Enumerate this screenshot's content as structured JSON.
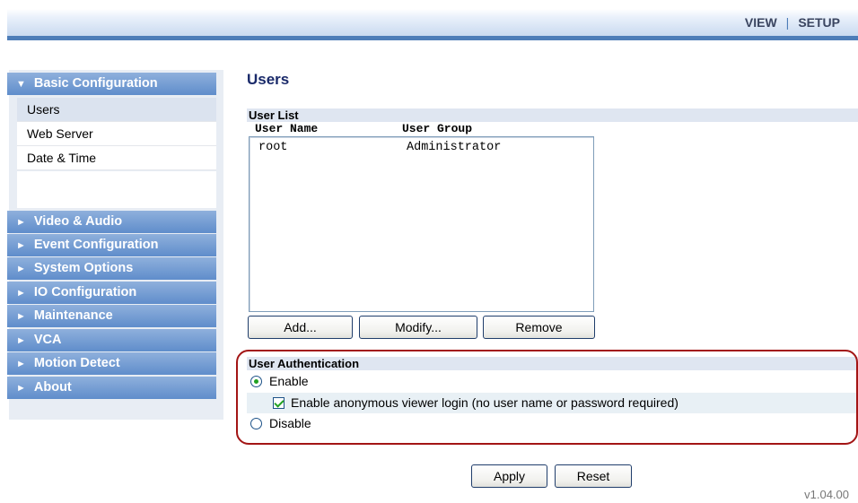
{
  "header": {
    "nav": [
      {
        "label": "VIEW"
      },
      {
        "label": "SETUP"
      }
    ],
    "separator": "|"
  },
  "sidebar": {
    "groups": [
      {
        "label": "Basic Configuration",
        "expanded": true,
        "items": [
          {
            "label": "Users",
            "active": true
          },
          {
            "label": "Web Server"
          },
          {
            "label": "Date & Time"
          }
        ]
      },
      {
        "label": "Video & Audio"
      },
      {
        "label": "Event Configuration"
      },
      {
        "label": "System Options"
      },
      {
        "label": "IO Configuration"
      },
      {
        "label": "Maintenance"
      },
      {
        "label": "VCA"
      },
      {
        "label": "Motion Detect"
      },
      {
        "label": "About"
      }
    ],
    "expanded_arrow": "▼",
    "collapsed_arrow": "►"
  },
  "main": {
    "title": "Users",
    "user_list": {
      "heading": "User List",
      "columns": [
        "User Name",
        "User Group"
      ],
      "rows": [
        [
          "root",
          "Administrator"
        ]
      ],
      "buttons": {
        "add": "Add...",
        "modify": "Modify...",
        "remove": "Remove"
      }
    },
    "auth": {
      "heading": "User Authentication",
      "enable_label": "Enable",
      "enable_checked": true,
      "anonymous_label": "Enable anonymous viewer login (no user name or password required)",
      "anonymous_checked": true,
      "disable_label": "Disable",
      "disable_checked": false
    },
    "actions": {
      "apply": "Apply",
      "reset": "Reset"
    }
  },
  "footer": {
    "version": "v1.04.00"
  },
  "colors": {
    "accent": "#5f8dcb",
    "header_line": "#4d7db8",
    "title": "#1a2a6a",
    "highlight_border": "#a31515"
  }
}
